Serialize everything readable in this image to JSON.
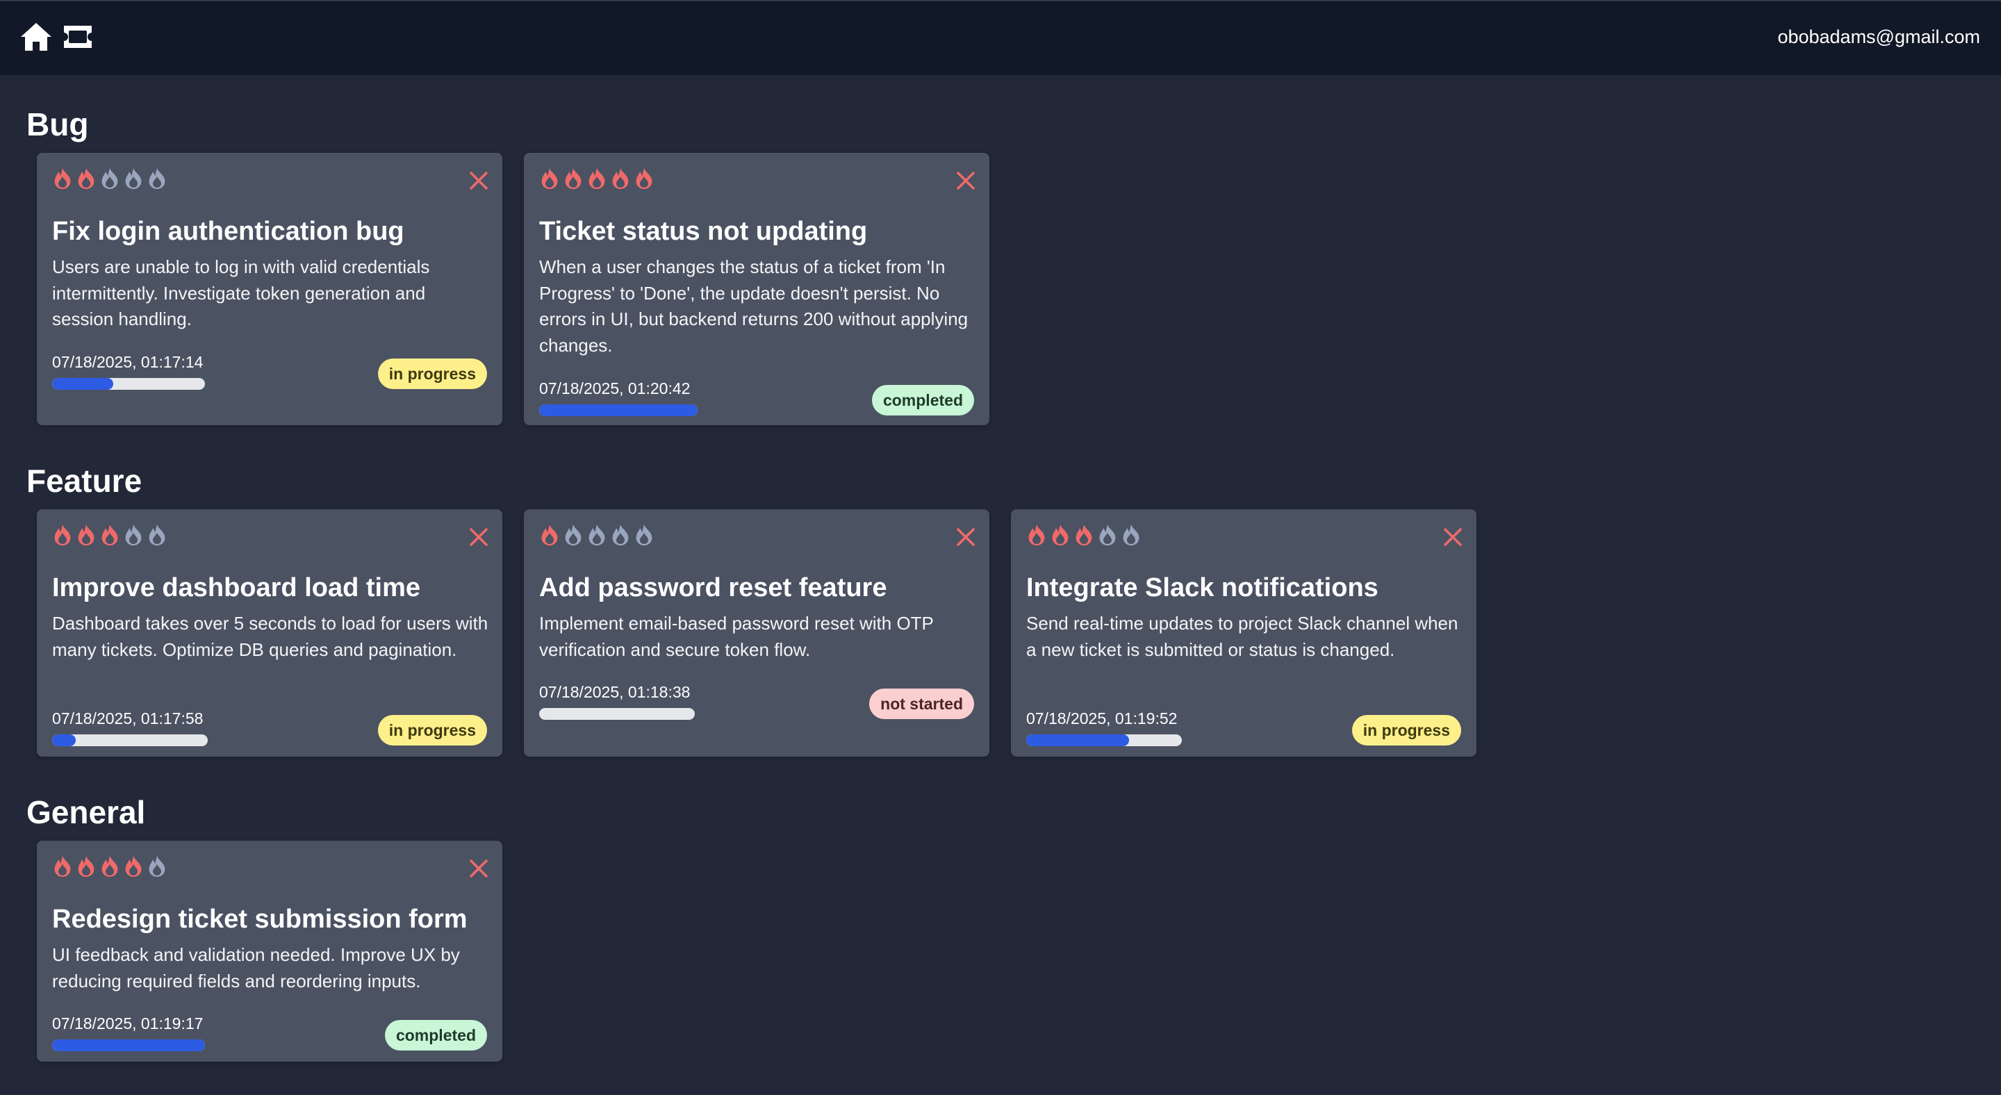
{
  "header": {
    "user_email": "obobadams@gmail.com",
    "icons": [
      "home-icon",
      "ticket-icon"
    ]
  },
  "colors": {
    "flame_active": "#f06a6a",
    "flame_inactive": "#9aa6bd",
    "close": "#f06a6a",
    "progress_fill": "#2d5be3",
    "in_progress_badge": "#fdf08a",
    "completed_badge": "#c8f6d6",
    "not_started_badge": "#fbcfd0"
  },
  "sections": [
    {
      "title": "Bug",
      "tickets": [
        {
          "priority": 2,
          "title": "Fix login authentication bug",
          "description": "Users are unable to log in with valid credentials intermittently. Investigate token generation and session handling.",
          "date": "07/18/2025, 01:17:14",
          "progress": 0.4,
          "status": "in progress"
        },
        {
          "priority": 5,
          "title": "Ticket status not updating",
          "description": "When a user changes the status of a ticket from 'In Progress' to 'Done', the update doesn't persist. No errors in UI, but backend returns 200 without applying changes.",
          "date": "07/18/2025, 01:20:42",
          "progress": 1.0,
          "status": "completed"
        }
      ]
    },
    {
      "title": "Feature",
      "tickets": [
        {
          "priority": 3,
          "title": "Improve dashboard load time",
          "description": "Dashboard takes over 5 seconds to load for users with many tickets. Optimize DB queries and pagination.",
          "date": "07/18/2025, 01:17:58",
          "progress": 0.15,
          "status": "in progress"
        },
        {
          "priority": 1,
          "title": "Add password reset feature",
          "description": "Implement email-based password reset with OTP verification and secure token flow.",
          "date": "07/18/2025, 01:18:38",
          "progress": 0.0,
          "status": "not started"
        },
        {
          "priority": 3,
          "title": "Integrate Slack notifications",
          "description": "Send real-time updates to project Slack channel when a new ticket is submitted or status is changed.",
          "date": "07/18/2025, 01:19:52",
          "progress": 0.66,
          "status": "in progress"
        }
      ]
    },
    {
      "title": "General",
      "tickets": [
        {
          "priority": 4,
          "title": "Redesign ticket submission form",
          "description": "UI feedback and validation needed. Improve UX by reducing required fields and reordering inputs.",
          "date": "07/18/2025, 01:19:17",
          "progress": 1.0,
          "status": "completed"
        }
      ]
    }
  ]
}
